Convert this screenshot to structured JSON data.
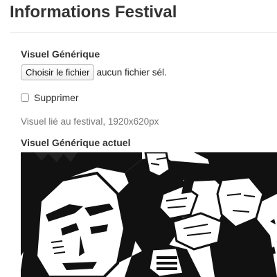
{
  "page": {
    "title": "Informations Festival"
  },
  "form": {
    "visual_label": "Visuel Générique",
    "file_input": {
      "button_label": "Choisir le fichier",
      "status_text": "aucun fichier sél."
    },
    "delete_checkbox": {
      "label": "Supprimer",
      "checked": false
    },
    "help_text": "Visuel lié au festival, 1920x620px",
    "current_visual_label": "Visuel Générique actuel"
  },
  "current_image": {
    "kind": "black-and-white comic illustration"
  },
  "colors": {
    "text": "#333333",
    "help_text": "#777777",
    "divider": "#e5e5e5",
    "checkbox_border": "#8f8f8f"
  }
}
